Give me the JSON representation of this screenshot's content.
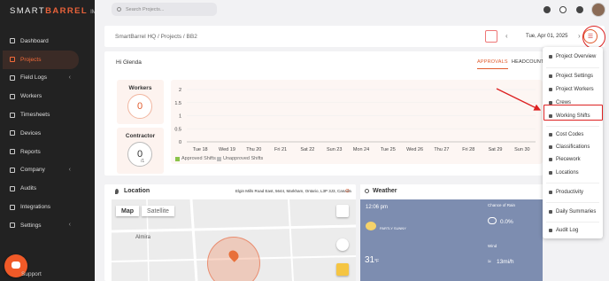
{
  "brand": {
    "name_pre": "SMART",
    "name_bold": "BARREL",
    "suffix": "IM"
  },
  "nav": [
    {
      "label": "Dashboard",
      "icon": "dashboard-icon",
      "active": false,
      "chev": false
    },
    {
      "label": "Projects",
      "icon": "folder-icon",
      "active": true,
      "chev": false
    },
    {
      "label": "Field Logs",
      "icon": "field-logs-icon",
      "active": false,
      "chev": true
    },
    {
      "label": "Workers",
      "icon": "workers-icon",
      "active": false,
      "chev": false
    },
    {
      "label": "Timesheets",
      "icon": "timesheets-icon",
      "active": false,
      "chev": false
    },
    {
      "label": "Devices",
      "icon": "devices-icon",
      "active": false,
      "chev": false
    },
    {
      "label": "Reports",
      "icon": "reports-icon",
      "active": false,
      "chev": false
    },
    {
      "label": "Company",
      "icon": "company-icon",
      "active": false,
      "chev": true
    },
    {
      "label": "Audits",
      "icon": "audits-icon",
      "active": false,
      "chev": false
    },
    {
      "label": "Integrations",
      "icon": "integrations-icon",
      "active": false,
      "chev": false
    },
    {
      "label": "Settings",
      "icon": "settings-icon",
      "active": false,
      "chev": true
    }
  ],
  "support": "Support",
  "search": {
    "placeholder": "Search Projects..."
  },
  "breadcrumb": "SmartBarrel HQ  /  Projects  /  BB2",
  "date": "Tue, Apr 01, 2025",
  "greeting": "Hi Glenda",
  "tabs": [
    "APPROVALS",
    "HEADCOUNTS"
  ],
  "workers": {
    "label": "Workers",
    "value": "0"
  },
  "contractor": {
    "label": "Contractor",
    "value": "0",
    "sub": "/1"
  },
  "chart_data": {
    "type": "bar",
    "categories": [
      "Tue 18",
      "Wed 19",
      "Thu 20",
      "Fri 21",
      "Sat 22",
      "Sun 23",
      "Mon 24",
      "Tue 25",
      "Wed 26",
      "Thu 27",
      "Fri 28",
      "Sat 29",
      "Sun 30"
    ],
    "series": [
      {
        "name": "Approved Shifts",
        "values": [
          0,
          0,
          0,
          0,
          0,
          0,
          0,
          0,
          0,
          0,
          0,
          0,
          0
        ]
      },
      {
        "name": "Unapproved Shifts",
        "values": [
          0,
          0,
          0,
          0,
          0,
          0,
          0,
          0,
          0,
          0,
          0,
          0,
          0
        ]
      }
    ],
    "yticks": [
      "2",
      "1.5",
      "1",
      "0.5",
      "0"
    ],
    "ylim": [
      0,
      2
    ],
    "colors": {
      "approved": "#8bc34a",
      "unapproved": "#bdbdbd"
    }
  },
  "location": {
    "title": "Location",
    "address": "Elgin Mills Road East, 5644, Markham, Ontario, L3P 3J3, Canada",
    "map_tab": "Map",
    "sat_tab": "Satellite",
    "town": "Almira"
  },
  "weather": {
    "title": "Weather",
    "time": "12:06 pm",
    "cond": "PARTLY SUNNY",
    "temp": "31",
    "unit": "°F",
    "rain_label": "Chance of Rain",
    "rain": "0.0%",
    "wind_label": "Wind",
    "wind": "13mi/h"
  },
  "menu": [
    {
      "label": "Project Overview",
      "icon": "overview-icon"
    },
    {
      "label": "Project Settings",
      "icon": "gear-icon"
    },
    {
      "label": "Project Workers",
      "icon": "person-icon"
    },
    {
      "label": "Crews",
      "icon": "crews-icon"
    },
    {
      "label": "Working Shifts",
      "icon": "shifts-icon"
    },
    {
      "label": "Cost Codes",
      "icon": "cost-codes-icon"
    },
    {
      "label": "Classifications",
      "icon": "classifications-icon"
    },
    {
      "label": "Piecework",
      "icon": "piecework-icon"
    },
    {
      "label": "Locations",
      "icon": "location-pin-icon"
    },
    {
      "label": "Productivity",
      "icon": "productivity-icon"
    },
    {
      "label": "Daily Summaries",
      "icon": "summaries-icon"
    },
    {
      "label": "Audit Log",
      "icon": "audit-log-icon"
    }
  ]
}
